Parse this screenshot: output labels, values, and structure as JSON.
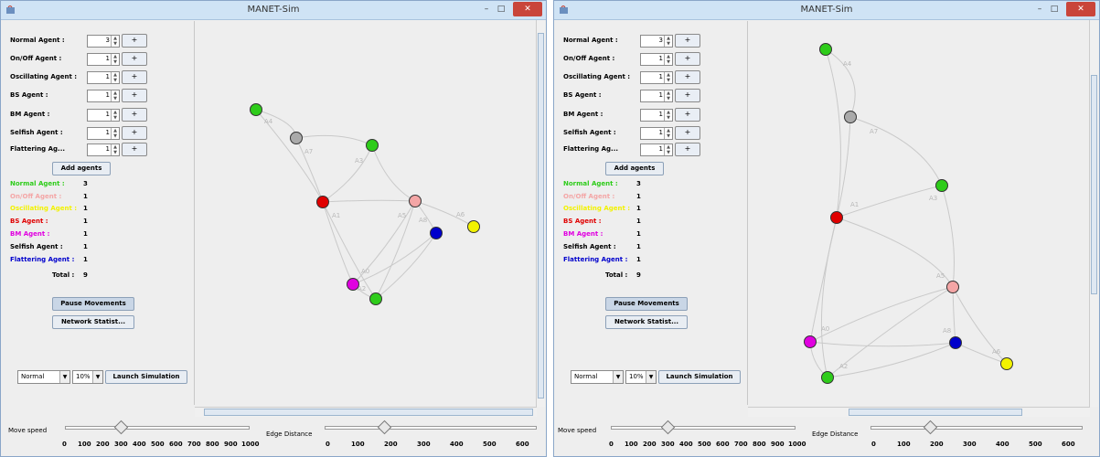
{
  "window_title": "MANET-Sim",
  "window_controls": {
    "minimize": "–",
    "maximize": "□",
    "close": "✕"
  },
  "agent_rows": [
    {
      "label": "Normal Agent :"
    },
    {
      "label": "On/Off Agent :"
    },
    {
      "label": "Oscillating Agent :"
    },
    {
      "label": "BS Agent :"
    },
    {
      "label": "BM Agent :"
    },
    {
      "label": "Selfish Agent :"
    },
    {
      "label": "Flattering Ag..."
    }
  ],
  "plus_label": "+",
  "add_agents_label": "Add agents",
  "counts": [
    {
      "label": "Normal Agent :",
      "color": "#2ecc1a"
    },
    {
      "label": "On/Off Agent :",
      "color": "#f4a6a6"
    },
    {
      "label": "Oscillating Agent :",
      "color": "#f2f200"
    },
    {
      "label": "BS Agent :",
      "color": "#e00000"
    },
    {
      "label": "BM Agent :",
      "color": "#e000e0"
    },
    {
      "label": "Selfish Agent :",
      "color": "#000000"
    },
    {
      "label": "Flattering Agent :",
      "color": "#0000cc"
    }
  ],
  "total_label": "Total :",
  "pause_label": "Pause Movements",
  "network_stats_label": "Network Statist...",
  "mode_combo": "Normal",
  "pct_combo": "10%",
  "launch_label": "Launch Simulation",
  "move_speed_label": "Move speed",
  "move_speed_ticks": [
    "0",
    "100",
    "200",
    "300",
    "400",
    "500",
    "600",
    "700",
    "800",
    "900",
    "1000"
  ],
  "move_speed_value": 300,
  "edge_distance_label": "Edge Distance",
  "edge_distance_ticks": [
    "0",
    "100",
    "200",
    "300",
    "400",
    "500",
    "600"
  ],
  "edge_distance_value": 190,
  "windows": [
    {
      "agent_values": [
        "3",
        "1",
        "1",
        "1",
        "1",
        "1",
        "1"
      ],
      "count_values": [
        "3",
        "1",
        "1",
        "1",
        "1",
        "1",
        "1"
      ],
      "total": "9",
      "edge_label_color": "#b8b8b8",
      "edge_color": "#c9c9c9",
      "edge_labels": [
        "A4",
        "A7",
        "A3",
        "A1",
        "A5",
        "A8",
        "A6",
        "A0",
        "A2"
      ]
    },
    {
      "agent_values": [
        "3",
        "1",
        "1",
        "1",
        "1",
        "1",
        "1"
      ],
      "count_values": [
        "3",
        "1",
        "1",
        "1",
        "1",
        "1",
        "1"
      ],
      "total": "9",
      "edge_label_color": "#b8b8b8",
      "edge_color": "#c9c9c9",
      "edge_labels": [
        "A4",
        "A7",
        "A3",
        "A1",
        "A5",
        "A0",
        "A8",
        "A6",
        "A2"
      ]
    }
  ]
}
